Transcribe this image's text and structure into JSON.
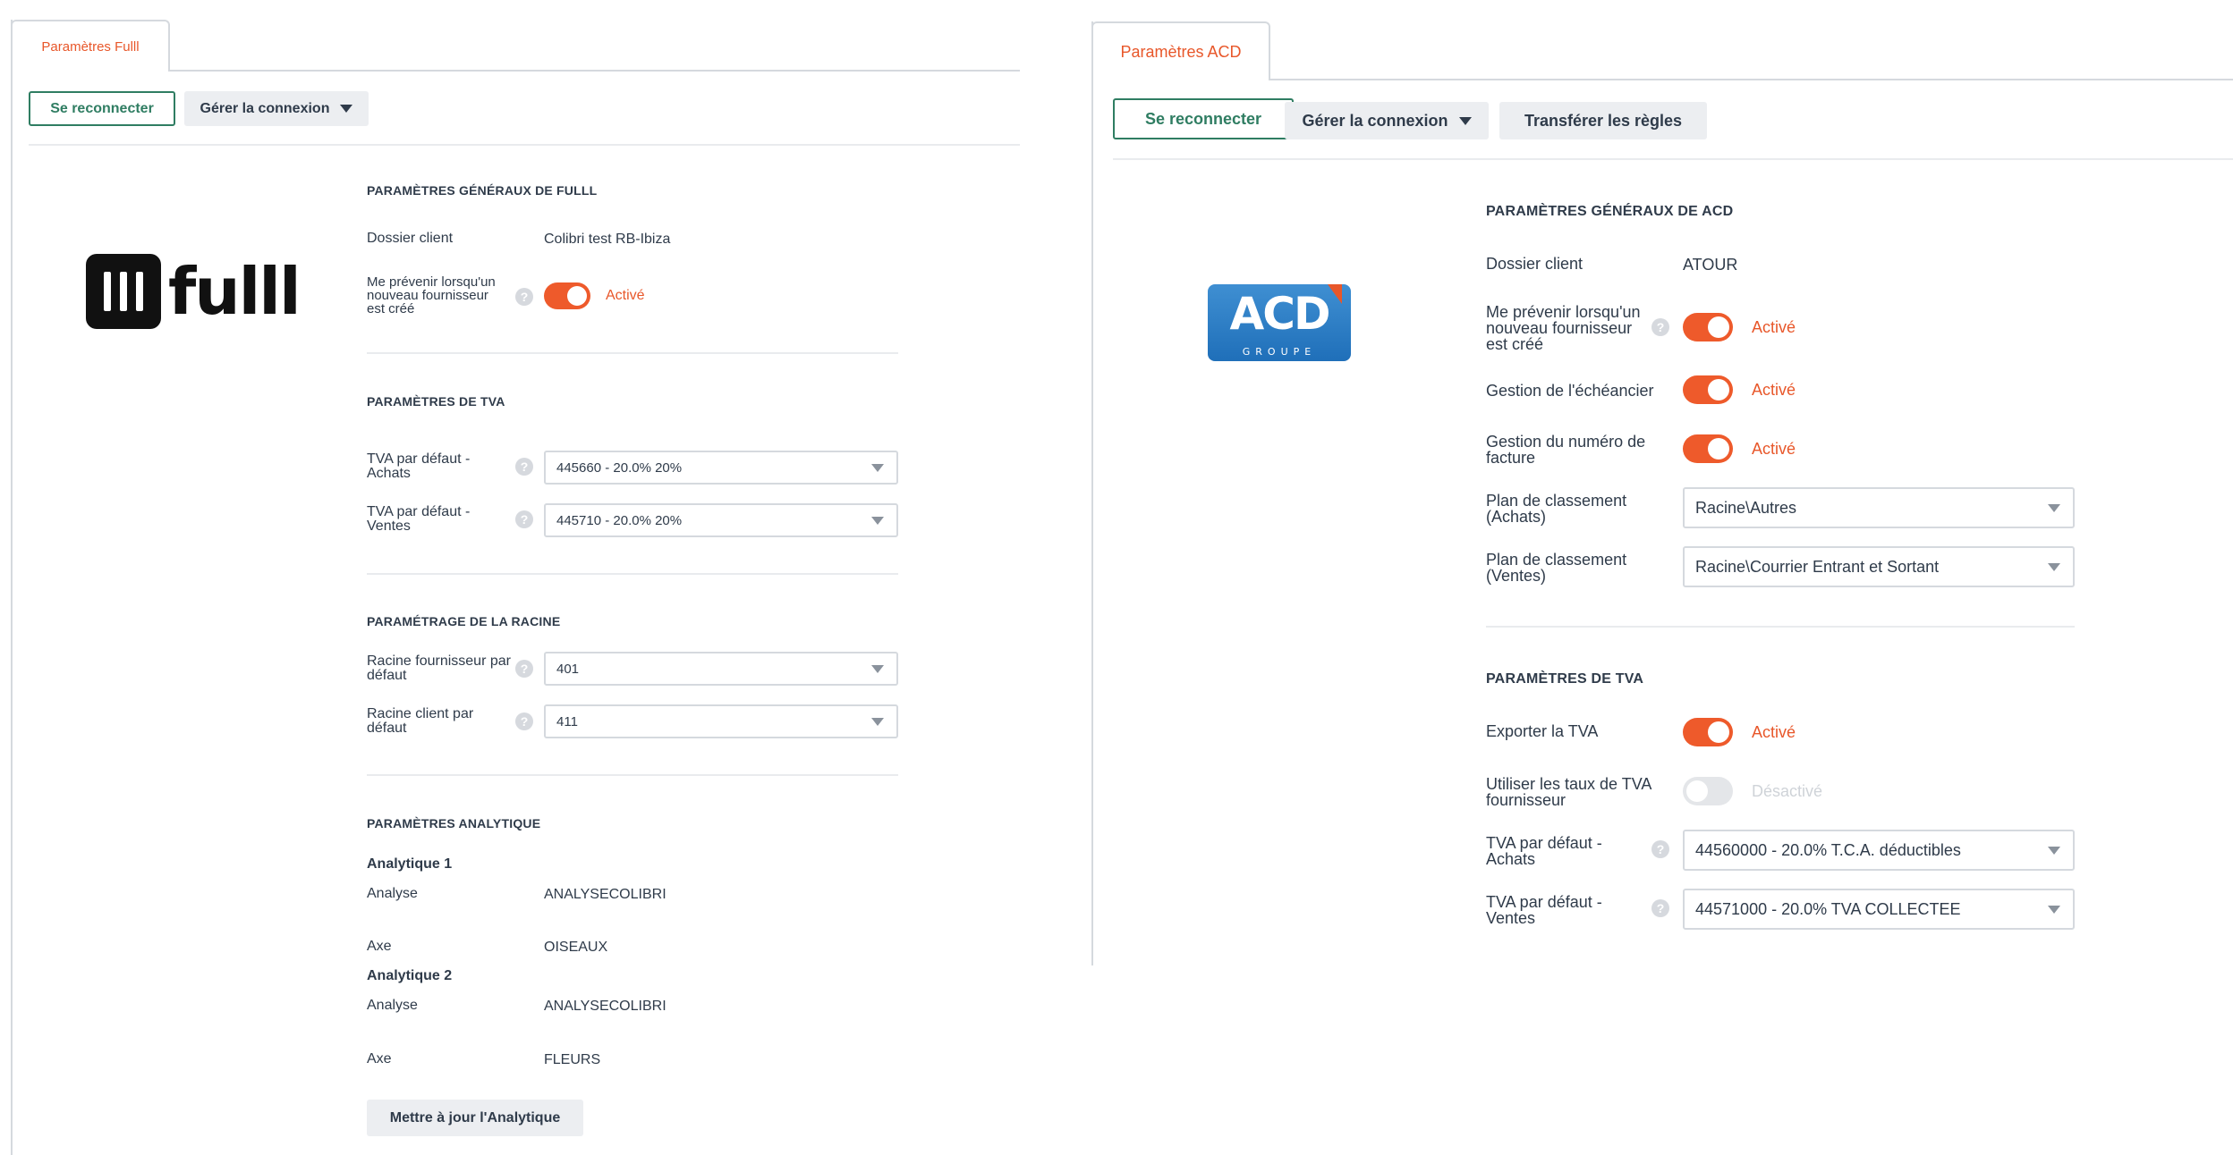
{
  "fulll": {
    "tab_label": "Paramètres Fulll",
    "reconnect_label": "Se reconnecter",
    "manage_label": "Gérer la connexion",
    "logo_text": "fulll",
    "general": {
      "title": "Paramètres généraux de Fulll",
      "client_label": "Dossier client",
      "client_value": "Colibri test RB-Ibiza",
      "notify_label": "Me prévenir lorsqu'un nouveau fournisseur est créé",
      "notify_status": "Activé"
    },
    "tva": {
      "title": "Paramètres de TVA",
      "purchases_label": "TVA par défaut - Achats",
      "purchases_value": "445660 - 20.0% 20%",
      "sales_label": "TVA par défaut - Ventes",
      "sales_value": "445710 - 20.0% 20%"
    },
    "racine": {
      "title": "Paramétrage de la racine",
      "supplier_label": "Racine fournisseur par défaut",
      "supplier_value": "401",
      "client_label": "Racine client par défaut",
      "client_value": "411"
    },
    "analytics": {
      "title": "Paramètres analytique",
      "groups": [
        {
          "name": "Analytique 1",
          "analyse_label": "Analyse",
          "analyse_value": "ANALYSECOLIBRI",
          "axe_label": "Axe",
          "axe_value": "OISEAUX"
        },
        {
          "name": "Analytique 2",
          "analyse_label": "Analyse",
          "analyse_value": "ANALYSECOLIBRI",
          "axe_label": "Axe",
          "axe_value": "FLEURS"
        }
      ],
      "update_label": "Mettre à jour l'Analytique"
    }
  },
  "acd": {
    "tab_label": "Paramètres ACD",
    "reconnect_label": "Se reconnecter",
    "manage_label": "Gérer la connexion",
    "transfer_label": "Transférer les règles",
    "logo_text": "ACD",
    "logo_subtext": "GROUPE",
    "general": {
      "title": "Paramètres généraux de ACD",
      "client_label": "Dossier client",
      "client_value": "ATOUR",
      "notify_label": "Me prévenir lorsqu'un nouveau fournisseur est créé",
      "notify_status": "Activé",
      "schedule_label": "Gestion de l'échéancier",
      "schedule_status": "Activé",
      "invoice_label": "Gestion du numéro de facture",
      "invoice_status": "Activé",
      "plan_purchases_label": "Plan de classement (Achats)",
      "plan_purchases_value": "Racine\\Autres",
      "plan_sales_label": "Plan de classement (Ventes)",
      "plan_sales_value": "Racine\\Courrier Entrant et Sortant"
    },
    "tva": {
      "title": "Paramètres de TVA",
      "export_label": "Exporter la TVA",
      "export_status": "Activé",
      "supplier_rates_label": "Utiliser les taux de TVA fournisseur",
      "supplier_rates_status": "Désactivé",
      "purchases_label": "TVA par défaut - Achats",
      "purchases_value": "44560000 - 20.0% T.C.A. déductibles",
      "sales_label": "TVA par défaut - Ventes",
      "sales_value": "44571000 - 20.0% TVA COLLECTEE"
    }
  },
  "colors": {
    "accent": "#e8572a",
    "toggle_on": "#ee5a2b",
    "primary_green": "#2f7d62",
    "text": "#2f3b4a",
    "border": "#d5d9de"
  }
}
